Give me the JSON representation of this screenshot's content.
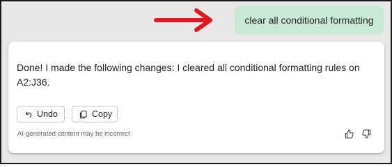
{
  "user_message": "clear all conditional formatting",
  "response": {
    "text": "Done! I made the following changes: I cleared all conditional formatting rules on A2:J36.",
    "actions": [
      {
        "label": "Undo",
        "icon": "undo-icon"
      },
      {
        "label": "Copy",
        "icon": "copy-icon"
      }
    ],
    "disclaimer": "AI-generated content may be incorrect",
    "feedback": [
      {
        "icon": "thumbs-up-icon"
      },
      {
        "icon": "thumbs-down-icon"
      }
    ]
  },
  "colors": {
    "background": "#eae8e6",
    "user_bubble": "#c9e8d6",
    "annotation_arrow": "#e0191f",
    "card": "#ffffff",
    "text": "#242424",
    "muted_text": "#616161"
  }
}
